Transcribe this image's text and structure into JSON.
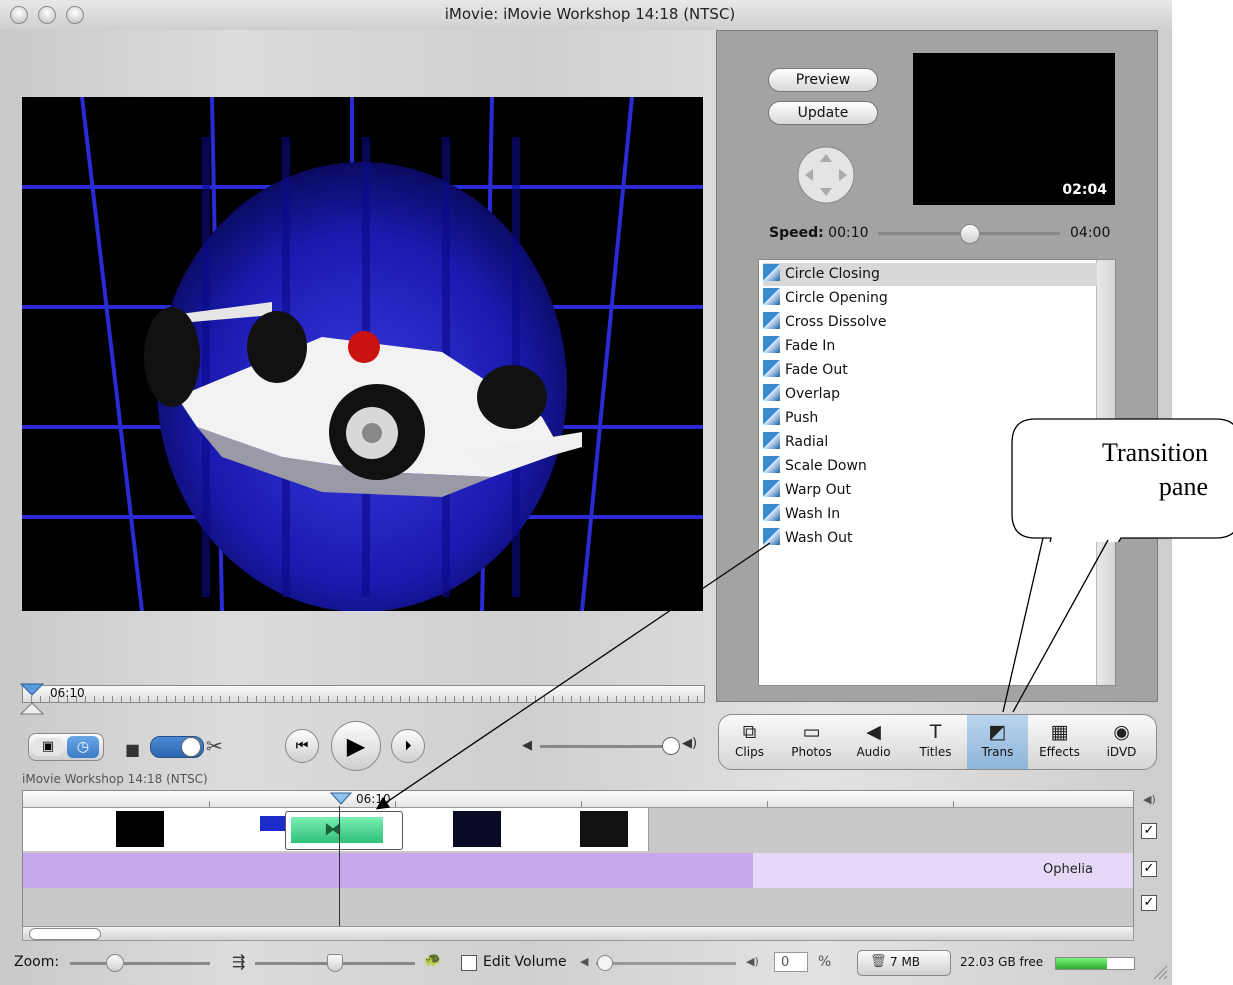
{
  "window": {
    "title": "iMovie: iMovie Workshop  14:18 (NTSC)"
  },
  "viewer": {
    "scrub_time": "06:10"
  },
  "transport": {
    "volume_icon": "speaker-icon"
  },
  "transition_panel": {
    "preview_label": "Preview",
    "update_label": "Update",
    "preview_time": "02:04",
    "speed_label": "Speed:",
    "speed_min": "00:10",
    "speed_max": "04:00",
    "speed_value": 0.5,
    "items": [
      {
        "label": "Circle Closing",
        "selected": true
      },
      {
        "label": "Circle Opening"
      },
      {
        "label": "Cross Dissolve"
      },
      {
        "label": "Fade In"
      },
      {
        "label": "Fade Out"
      },
      {
        "label": "Overlap"
      },
      {
        "label": "Push"
      },
      {
        "label": "Radial"
      },
      {
        "label": "Scale Down"
      },
      {
        "label": "Warp Out"
      },
      {
        "label": "Wash In"
      },
      {
        "label": "Wash Out"
      }
    ]
  },
  "tabs": [
    {
      "label": "Clips",
      "icon": "clips-icon"
    },
    {
      "label": "Photos",
      "icon": "photos-icon"
    },
    {
      "label": "Audio",
      "icon": "audio-icon"
    },
    {
      "label": "Titles",
      "icon": "titles-icon"
    },
    {
      "label": "Trans",
      "icon": "trans-icon",
      "selected": true
    },
    {
      "label": "Effects",
      "icon": "effects-icon"
    },
    {
      "label": "iDVD",
      "icon": "idvd-icon"
    }
  ],
  "timeline": {
    "project_label": "iMovie Workshop  14:18 (NTSC)",
    "playhead_time": "06:10",
    "audio_clip_name": "Ophelia"
  },
  "statusbar": {
    "zoom_label": "Zoom:",
    "edit_volume_label": "Edit Volume",
    "volume_value": "0",
    "percent_label": "%",
    "trash_size": "7 MB",
    "free_space": "22.03 GB free",
    "free_space_fraction": 0.65
  },
  "annotation": {
    "callout_line1": "Transition",
    "callout_line2": "pane"
  }
}
